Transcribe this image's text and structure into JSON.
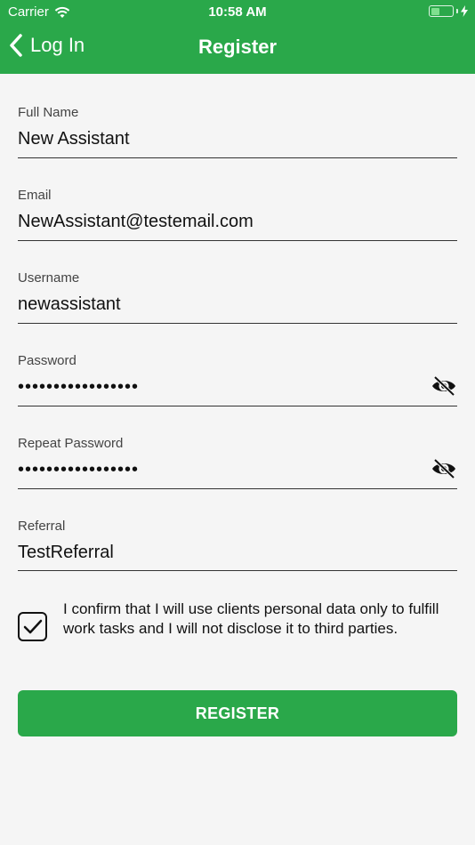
{
  "status_bar": {
    "carrier": "Carrier",
    "time": "10:58 AM"
  },
  "nav": {
    "back_label": "Log In",
    "title": "Register"
  },
  "form": {
    "full_name": {
      "label": "Full Name",
      "value": "New Assistant"
    },
    "email": {
      "label": "Email",
      "value": "NewAssistant@testemail.com"
    },
    "username": {
      "label": "Username",
      "value": "newassistant"
    },
    "password": {
      "label": "Password",
      "value": "•••••••••••••••••"
    },
    "repeat_password": {
      "label": "Repeat Password",
      "value": "•••••••••••••••••"
    },
    "referral": {
      "label": "Referral",
      "value": "TestReferral"
    }
  },
  "consent": {
    "text": "I confirm that I will use clients personal data only to fulfill work tasks and I will not disclose it to third parties.",
    "checked": true
  },
  "register_button": {
    "label": "REGISTER"
  },
  "colors": {
    "primary": "#2aa84a",
    "background": "#f5f5f5"
  },
  "icons": [
    "wifi-icon",
    "battery-icon",
    "charging-bolt-icon",
    "chevron-left-icon",
    "eye-off-icon",
    "checkmark-icon"
  ]
}
